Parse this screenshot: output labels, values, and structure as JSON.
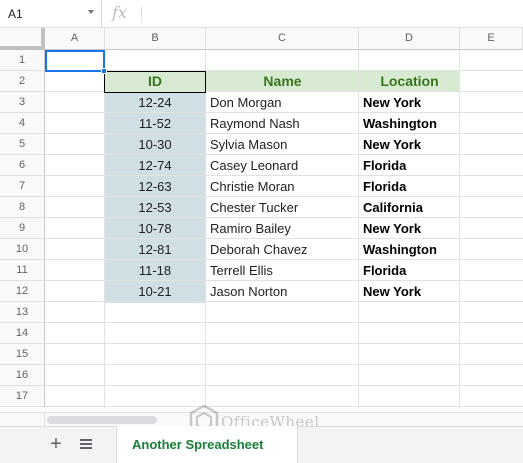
{
  "formula_bar": {
    "cell_ref": "A1",
    "fx_symbol": "fx",
    "formula": ""
  },
  "columns": [
    "A",
    "B",
    "C",
    "D",
    "E"
  ],
  "rows": [
    "1",
    "2",
    "3",
    "4",
    "5",
    "6",
    "7",
    "8",
    "9",
    "10",
    "11",
    "12",
    "13",
    "14",
    "15",
    "16",
    "17"
  ],
  "table": {
    "headers": {
      "id": "ID",
      "name": "Name",
      "location": "Location"
    },
    "records": [
      {
        "id": "12-24",
        "name": "Don Morgan",
        "location": "New York"
      },
      {
        "id": "11-52",
        "name": "Raymond Nash",
        "location": "Washington"
      },
      {
        "id": "10-30",
        "name": "Sylvia Mason",
        "location": "New York"
      },
      {
        "id": "12-74",
        "name": "Casey Leonard",
        "location": "Florida"
      },
      {
        "id": "12-63",
        "name": "Christie Moran",
        "location": "Florida"
      },
      {
        "id": "12-53",
        "name": "Chester Tucker",
        "location": "California"
      },
      {
        "id": "10-78",
        "name": "Ramiro Bailey",
        "location": "New York"
      },
      {
        "id": "12-81",
        "name": "Deborah Chavez",
        "location": "Washington"
      },
      {
        "id": "11-18",
        "name": "Terrell Ellis",
        "location": "Florida"
      },
      {
        "id": "10-21",
        "name": "Jason Norton",
        "location": "New York"
      }
    ]
  },
  "sheets": {
    "active_tab": "Another Spreadsheet",
    "add_icon": "plus-icon",
    "list_icon": "all-sheets-icon"
  },
  "watermark": {
    "text": "OfficeWheel"
  },
  "colors": {
    "header_fill": "#d9ead3",
    "header_text": "#38761d",
    "id_fill": "#d0dfe3",
    "selection": "#1a73e8",
    "tab_text": "#188038"
  }
}
